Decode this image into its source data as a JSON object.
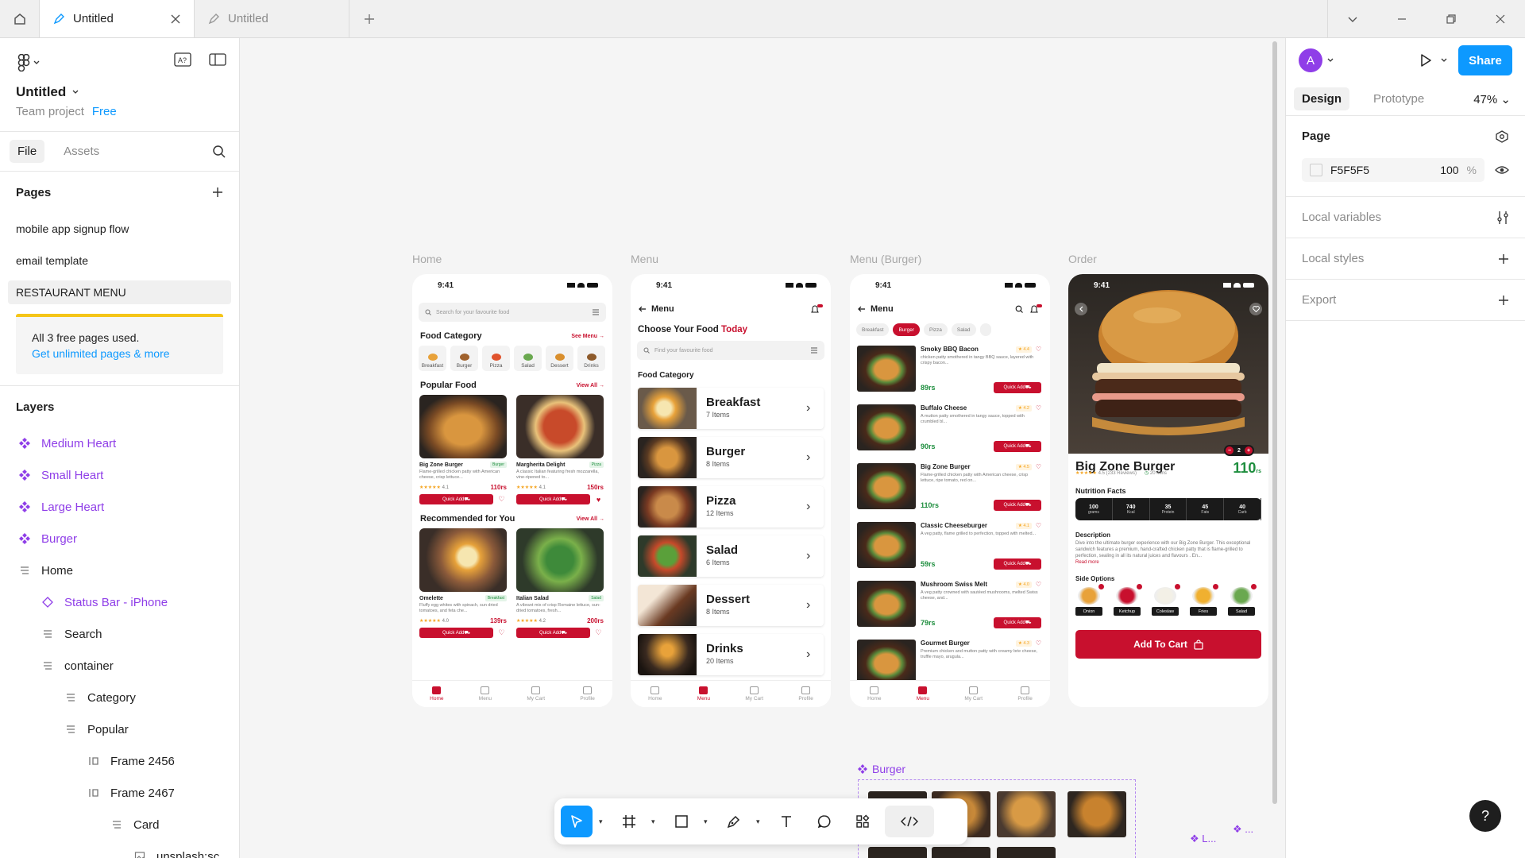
{
  "tabs": [
    {
      "label": "Untitled",
      "active": true
    },
    {
      "label": "Untitled",
      "active": false
    }
  ],
  "file": {
    "title": "Untitled",
    "team": "Team project",
    "plan": "Free"
  },
  "left_tabs": {
    "file": "File",
    "assets": "Assets"
  },
  "pages": {
    "heading": "Pages",
    "items": [
      "mobile app signup flow",
      "email template",
      "RESTAURANT MENU"
    ],
    "selected": "RESTAURANT MENU"
  },
  "upsell": {
    "text": "All 3 free pages used.",
    "link": "Get unlimited pages & more"
  },
  "layers": {
    "heading": "Layers",
    "items": [
      {
        "label": "Medium Heart",
        "kind": "component",
        "indent": 0
      },
      {
        "label": "Small Heart",
        "kind": "component",
        "indent": 0
      },
      {
        "label": "Large Heart",
        "kind": "component",
        "indent": 0
      },
      {
        "label": "Burger",
        "kind": "component",
        "indent": 0
      },
      {
        "label": "Home",
        "kind": "frame",
        "indent": 0
      },
      {
        "label": "Status Bar - iPhone",
        "kind": "instance",
        "indent": 1
      },
      {
        "label": "Search",
        "kind": "frame",
        "indent": 1
      },
      {
        "label": "container",
        "kind": "frame",
        "indent": 1
      },
      {
        "label": "Category",
        "kind": "frame",
        "indent": 2
      },
      {
        "label": "Popular",
        "kind": "frame",
        "indent": 2
      },
      {
        "label": "Frame 2456",
        "kind": "autolayout",
        "indent": 3
      },
      {
        "label": "Frame 2467",
        "kind": "autolayout",
        "indent": 3
      },
      {
        "label": "Card",
        "kind": "frame",
        "indent": 4
      },
      {
        "label": "unsplash:sc",
        "kind": "image",
        "indent": 5
      }
    ]
  },
  "frames": {
    "home": "Home",
    "menu": "Menu",
    "menu_burger": "Menu (Burger)",
    "order": "Order"
  },
  "phone_common": {
    "time": "9:41",
    "nav": [
      "Home",
      "Menu",
      "My Cart",
      "Profile"
    ]
  },
  "home": {
    "search_placeholder": "Search for your favourite food",
    "category_heading": "Food Category",
    "see_menu": "See Menu →",
    "categories": [
      "Breakfast",
      "Burger",
      "Pizza",
      "Salad",
      "Dessert",
      "Drinks"
    ],
    "popular_heading": "Popular Food",
    "view_all": "View All →",
    "popular": [
      {
        "name": "Big Zone Burger",
        "tag": "Burger",
        "desc": "Flame-grilled chicken patty with American cheese, crisp lettuce...",
        "rating": "4.1",
        "price": "110rs"
      },
      {
        "name": "Margherita Delight",
        "tag": "Pizza",
        "desc": "A classic Italian featuring fresh mozzarella, vine-ripened to...",
        "rating": "4.1",
        "price": "150rs"
      }
    ],
    "rec_heading": "Recommended for You",
    "recommended": [
      {
        "name": "Omelette",
        "tag": "Breakfast",
        "desc": "Fluffy egg whites with spinach, sun dried tomatoes, and feta che...",
        "rating": "4.0",
        "price": "139rs"
      },
      {
        "name": "Italian Salad",
        "tag": "Salad",
        "desc": "A vibrant mix of crisp Romaine lettuce, sun-dried tomatoes, fresh...",
        "rating": "4.2",
        "price": "200rs"
      }
    ],
    "quick_add": "Quick Add"
  },
  "menu": {
    "title": "Menu",
    "choose": "Choose Your Food",
    "today": "Today",
    "search_placeholder": "Find your favourite food",
    "category_heading": "Food Category",
    "items": [
      {
        "name": "Breakfast",
        "count": "7 Items"
      },
      {
        "name": "Burger",
        "count": "8 Items"
      },
      {
        "name": "Pizza",
        "count": "12 Items"
      },
      {
        "name": "Salad",
        "count": "6 Items"
      },
      {
        "name": "Dessert",
        "count": "8 Items"
      },
      {
        "name": "Drinks",
        "count": "20 Items"
      }
    ]
  },
  "menu_burger": {
    "title": "Menu",
    "chips": [
      "Breakfast",
      "Burger",
      "Pizza",
      "Salad"
    ],
    "active_chip": "Burger",
    "items": [
      {
        "name": "Smoky BBQ Bacon",
        "rating": "4.4",
        "desc": "chicken patty smothered in tangy BBQ sauce, layered with crispy bacon...",
        "price": "89rs"
      },
      {
        "name": "Buffalo Cheese",
        "rating": "4.2",
        "desc": "A mutton patty smothered in tangy sauce, topped with crumbled bl...",
        "price": "90rs"
      },
      {
        "name": "Big Zone Burger",
        "rating": "4.5",
        "desc": "Flame-grilled chicken patty with American cheese, crisp lettuce, ripe tomato, red on...",
        "price": "110rs"
      },
      {
        "name": "Classic Cheeseburger",
        "rating": "4.1",
        "desc": "A veg patty, flame grilled to perfection, topped with melted...",
        "price": "59rs"
      },
      {
        "name": "Mushroom Swiss Melt",
        "rating": "4.0",
        "desc": "A veg patty crowned with sautéed mushrooms, melted Swiss cheese, and...",
        "price": "79rs"
      },
      {
        "name": "Gourmet Burger",
        "rating": "4.3",
        "desc": "Premium chicken and mutton patty with creamy brie cheese, truffle mayo, arugula...",
        "price": ""
      }
    ]
  },
  "order": {
    "name": "Big Zone Burger",
    "rating": "4.5",
    "reviews": "(233 Reviews)",
    "time": "20 mins",
    "price": "110",
    "currency": "rs",
    "qty": "2",
    "nutrition_heading": "Nutrition Facts",
    "nutrition": [
      {
        "value": "100",
        "unit": "grams"
      },
      {
        "value": "740",
        "unit": "Kcal"
      },
      {
        "value": "35",
        "unit": "Protein"
      },
      {
        "value": "45",
        "unit": "Fats"
      },
      {
        "value": "40",
        "unit": "Carb"
      }
    ],
    "desc_heading": "Description",
    "desc": "Dive into the ultimate burger experience with our Big Zone Burger. This exceptional sandwich features a premium, hand-crafted chicken patty that is flame-grilled to perfection, sealing in all its natural juices and flavours . En...",
    "read_more": "Read more",
    "sides_heading": "Side Options",
    "sides": [
      "Onion",
      "Ketchup",
      "Coleslaw",
      "Fries",
      "Salad"
    ],
    "add_to_cart": "Add To Cart"
  },
  "canvas_component": {
    "label": "Burger"
  },
  "right": {
    "avatar": "A",
    "share": "Share",
    "tabs": [
      "Design",
      "Prototype"
    ],
    "zoom": "47%",
    "page_heading": "Page",
    "page_color": "F5F5F5",
    "page_opacity": "100",
    "percent": "%",
    "sections": [
      "Local variables",
      "Local styles",
      "Export"
    ]
  },
  "help": "?",
  "colors": {
    "accent": "#0d99ff",
    "component": "#8f3ee8",
    "brand_red": "#c8102e",
    "price_green": "#1e8e3e"
  }
}
